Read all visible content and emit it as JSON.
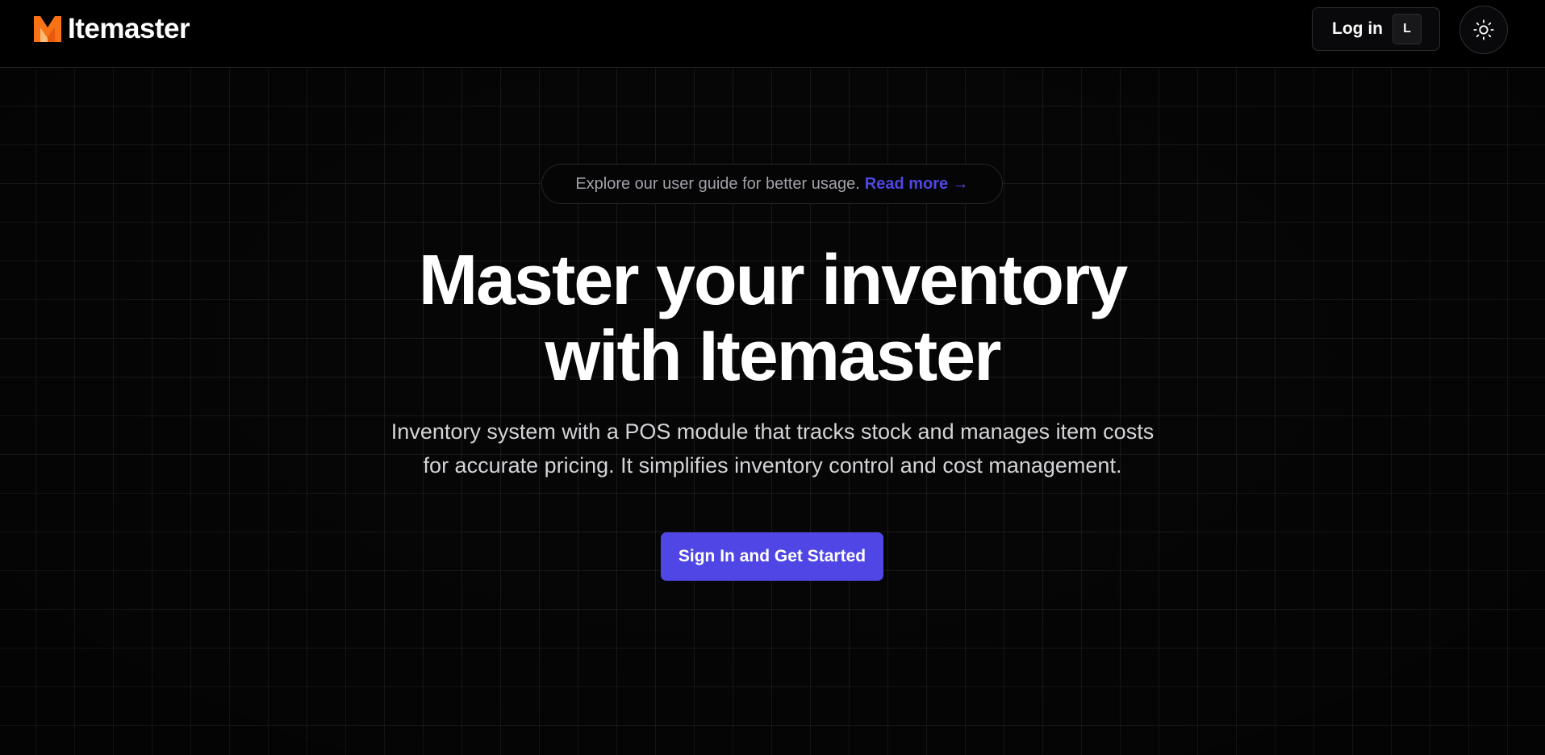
{
  "header": {
    "logo_text": "Itemaster",
    "logo_icon": "m-logo-icon",
    "login_label": "Log in",
    "login_shortcut": "L",
    "theme_icon": "sun-icon"
  },
  "announcement": {
    "text": "Explore our user guide for better usage.",
    "link_label": "Read more →"
  },
  "hero": {
    "title_line1": "Master your inventory",
    "title_line2": "with Itemaster",
    "description_line1": "Inventory system with a POS module that tracks stock and manages item costs",
    "description_line2": "for accurate pricing. It simplifies inventory control and cost management.",
    "cta_label": "Sign In and Get Started"
  },
  "colors": {
    "background": "#000000",
    "accent": "#4f46e5",
    "logo_orange": "#f97316"
  }
}
